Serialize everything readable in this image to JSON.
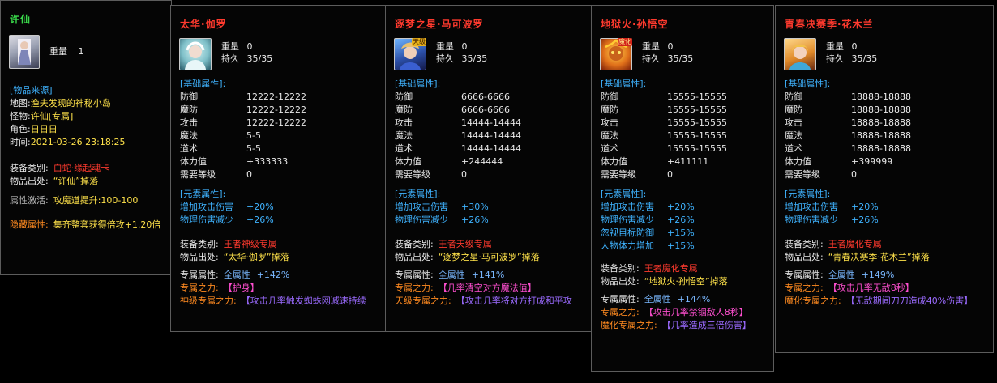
{
  "panels": [
    {
      "title": "许仙",
      "title_color": "#39d84a",
      "weight_label": "重量",
      "weight": "1",
      "source_header": "[物品来源]",
      "source": [
        {
          "label": "地图:",
          "value": "渔夫发现的神秘小岛"
        },
        {
          "label": "怪物:",
          "value": "许仙[专属]"
        },
        {
          "label": "角色:",
          "value": "日日日"
        },
        {
          "label": "时间:",
          "value": "2021-03-26 23:18:25"
        }
      ],
      "equip_type_label": "装备类别:",
      "equip_type": "白蛇·缘起魂卡",
      "drop_label": "物品出处:",
      "drop": "“许仙”掉落",
      "activate_label": "属性激活:",
      "activate": "攻魔道提升:100-100",
      "hidden_label": "隐藏属性:",
      "hidden": "集齐整套获得倍攻+1.20倍"
    },
    {
      "title": "太华·伽罗",
      "weight_label": "重量",
      "weight": "0",
      "dur_label": "持久",
      "durability": "35/35",
      "base_header": "[基础属性]:",
      "stats": [
        {
          "label": "防御",
          "value": "12222-12222"
        },
        {
          "label": "魔防",
          "value": "12222-12222"
        },
        {
          "label": "攻击",
          "value": "12222-12222"
        },
        {
          "label": "魔法",
          "value": "5-5"
        },
        {
          "label": "道术",
          "value": "5-5"
        },
        {
          "label": "体力值",
          "value": "+333333"
        },
        {
          "label": "需要等级",
          "value": "0"
        }
      ],
      "elem_header": "[元素属性]:",
      "elements": [
        {
          "label": "增加攻击伤害",
          "value": "+20%"
        },
        {
          "label": "物理伤害减少",
          "value": "+26%"
        }
      ],
      "equip_type_label": "装备类别:",
      "equip_type": "王者神级专属",
      "drop_label": "物品出处:",
      "drop": "“太华·伽罗”掉落",
      "excl_label": "专属属性:",
      "excl_value": "全属性",
      "excl_bonus": "+142%",
      "power_label": "专属之力:",
      "power": "【护身】",
      "extra_label": "神级专属之力:",
      "extra": "【攻击几率触发蜘蛛网减速持续"
    },
    {
      "title": "逐梦之星·马可波罗",
      "weight_label": "重量",
      "weight": "0",
      "dur_label": "持久",
      "durability": "35/35",
      "base_header": "[基础属性]:",
      "stats": [
        {
          "label": "防御",
          "value": "6666-6666"
        },
        {
          "label": "魔防",
          "value": "6666-6666"
        },
        {
          "label": "攻击",
          "value": "14444-14444"
        },
        {
          "label": "魔法",
          "value": "14444-14444"
        },
        {
          "label": "道术",
          "value": "14444-14444"
        },
        {
          "label": "体力值",
          "value": "+244444"
        },
        {
          "label": "需要等级",
          "value": "0"
        }
      ],
      "elem_header": "[元素属性]:",
      "elements": [
        {
          "label": "增加攻击伤害",
          "value": "+30%"
        },
        {
          "label": "物理伤害减少",
          "value": "+26%"
        }
      ],
      "equip_type_label": "装备类别:",
      "equip_type": "王者天级专属",
      "drop_label": "物品出处:",
      "drop": "“逐梦之星·马可波罗”掉落",
      "excl_label": "专属属性:",
      "excl_value": "全属性",
      "excl_bonus": "+141%",
      "power_label": "专属之力:",
      "power": "【几率清空对方魔法值】",
      "extra_label": "天级专属之力:",
      "extra": "【攻击几率将对方打成和平攻"
    },
    {
      "title": "地狱火·孙悟空",
      "weight_label": "重量",
      "weight": "0",
      "dur_label": "持久",
      "durability": "35/35",
      "base_header": "[基础属性]:",
      "stats": [
        {
          "label": "防御",
          "value": "15555-15555"
        },
        {
          "label": "魔防",
          "value": "15555-15555"
        },
        {
          "label": "攻击",
          "value": "15555-15555"
        },
        {
          "label": "魔法",
          "value": "15555-15555"
        },
        {
          "label": "道术",
          "value": "15555-15555"
        },
        {
          "label": "体力值",
          "value": "+411111"
        },
        {
          "label": "需要等级",
          "value": "0"
        }
      ],
      "elem_header": "[元素属性]:",
      "elements": [
        {
          "label": "增加攻击伤害",
          "value": "+20%"
        },
        {
          "label": "物理伤害减少",
          "value": "+26%"
        },
        {
          "label": "忽视目标防御",
          "value": "+15%"
        },
        {
          "label": "人物体力增加",
          "value": "+15%"
        }
      ],
      "equip_type_label": "装备类别:",
      "equip_type": "王者魔化专属",
      "drop_label": "物品出处:",
      "drop": "“地狱火·孙悟空”掉落",
      "excl_label": "专属属性:",
      "excl_value": "全属性",
      "excl_bonus": "+144%",
      "power_label": "专属之力:",
      "power": "【攻击几率禁锢敌人8秒】",
      "extra_label": "魔化专属之力:",
      "extra": "【几率造成三倍伤害】"
    },
    {
      "title": "青春决赛季·花木兰",
      "weight_label": "重量",
      "weight": "0",
      "dur_label": "持久",
      "durability": "35/35",
      "base_header": "[基础属性]:",
      "stats": [
        {
          "label": "防御",
          "value": "18888-18888"
        },
        {
          "label": "魔防",
          "value": "18888-18888"
        },
        {
          "label": "攻击",
          "value": "18888-18888"
        },
        {
          "label": "魔法",
          "value": "18888-18888"
        },
        {
          "label": "道术",
          "value": "18888-18888"
        },
        {
          "label": "体力值",
          "value": "+399999"
        },
        {
          "label": "需要等级",
          "value": "0"
        }
      ],
      "elem_header": "[元素属性]:",
      "elements": [
        {
          "label": "增加攻击伤害",
          "value": "+20%"
        },
        {
          "label": "物理伤害减少",
          "value": "+26%"
        }
      ],
      "equip_type_label": "装备类别:",
      "equip_type": "王者魔化专属",
      "drop_label": "物品出处:",
      "drop": "“青春决赛季·花木兰”掉落",
      "excl_label": "专属属性:",
      "excl_value": "全属性",
      "excl_bonus": "+149%",
      "power_label": "专属之力:",
      "power": "【攻击几率无敌8秒】",
      "extra_label": "魔化专属之力:",
      "extra": "【无敌期间刀刀造成40%伤害】"
    }
  ],
  "avatar_badges": {
    "p2": "天级",
    "p3": "魔化"
  }
}
